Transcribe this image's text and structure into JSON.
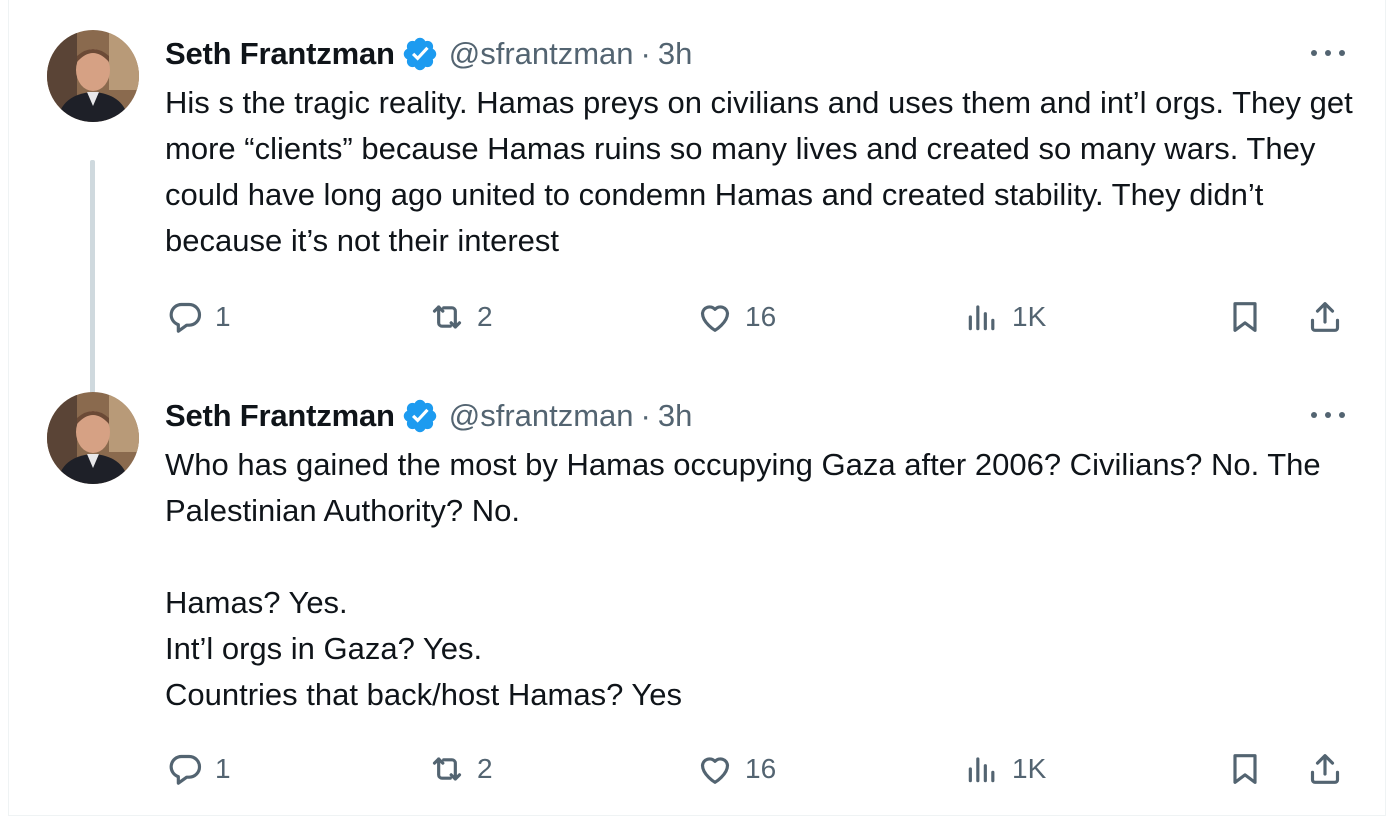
{
  "tweets": [
    {
      "author": "Seth Frantzman",
      "handle": "@sfrantzman",
      "separator": "·",
      "time": "3h",
      "text": "His s the tragic reality. Hamas preys on civilians and uses them and int’l orgs. They get more “clients” because Hamas ruins so many lives and created so many wars. They could have long ago united to condemn Hamas and created stability. They didn’t because it’s not their interest",
      "replies": "1",
      "retweets": "2",
      "likes": "16",
      "views": "1K"
    },
    {
      "author": "Seth Frantzman",
      "handle": "@sfrantzman",
      "separator": "·",
      "time": "3h",
      "text": "Who has gained the most by Hamas occupying Gaza after 2006? Civilians? No. The Palestinian Authority? No.\n\nHamas? Yes.\nInt’l orgs in Gaza? Yes.\nCountries that back/host Hamas? Yes",
      "replies": "1",
      "retweets": "2",
      "likes": "16",
      "views": "1K"
    }
  ],
  "colors": {
    "verified": "#1d9bf0",
    "muted": "#536471",
    "text": "#0f1419",
    "thread_line": "#cfd9de"
  },
  "icons": [
    "verified-badge-icon",
    "more-icon",
    "reply-icon",
    "retweet-icon",
    "like-icon",
    "views-icon",
    "bookmark-icon",
    "share-icon"
  ]
}
